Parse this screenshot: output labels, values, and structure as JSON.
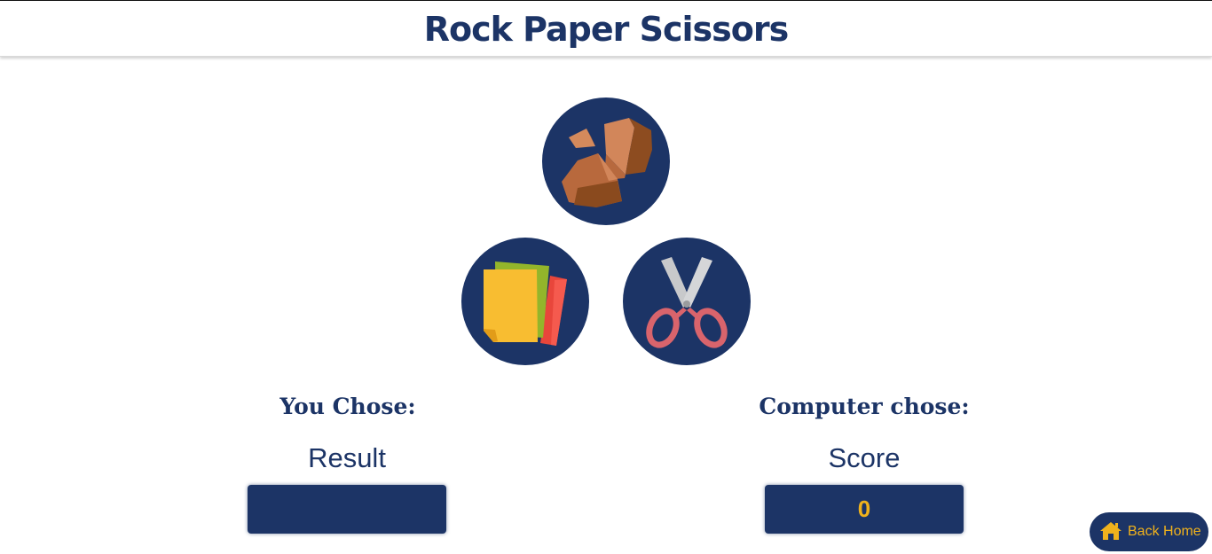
{
  "header": {
    "title": "Rock Paper Scissors"
  },
  "choices": [
    {
      "name": "rock",
      "icon": "rock-icon"
    },
    {
      "name": "paper",
      "icon": "paper-icon"
    },
    {
      "name": "scissors",
      "icon": "scissors-icon"
    }
  ],
  "player": {
    "chose_label": "You Chose:",
    "result_label": "Result",
    "result_value": ""
  },
  "computer": {
    "chose_label": "Computer chose:",
    "score_label": "Score",
    "score_value": "0"
  },
  "nav": {
    "back_home_label": "Back Home",
    "back_home_icon": "home-icon"
  },
  "colors": {
    "primary": "#1c3466",
    "accent": "#f0b21c",
    "background": "#ffffff"
  }
}
